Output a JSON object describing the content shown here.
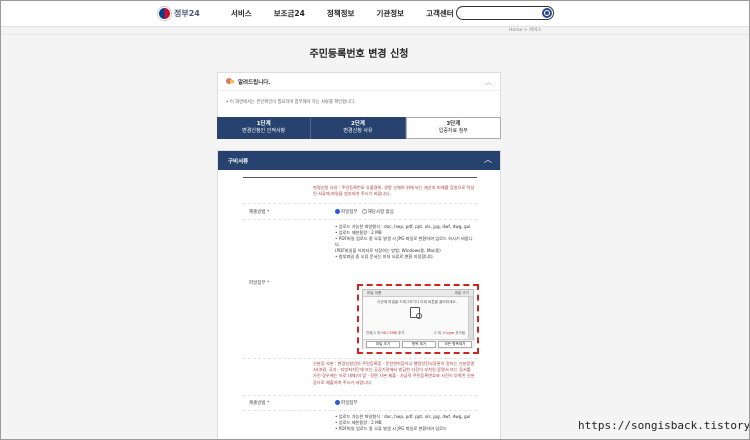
{
  "header": {
    "logo_text": "정부24",
    "nav": [
      "서비스",
      "보조금24",
      "정책정보",
      "기관정보",
      "고객센터"
    ],
    "search_placeholder": ""
  },
  "breadcrumb": "Home  >  서비스",
  "page_title": "주민등록번호 변경 신청",
  "notice": {
    "title": "알려드립니다.",
    "body": "• 이 화면에서는 본인확인이 필요하며 첨부해야 하는 서류를 확인합니다."
  },
  "steps": [
    {
      "num": "1단계",
      "label": "변경신청인 인적사항"
    },
    {
      "num": "2단계",
      "label": "변경신청 사유"
    },
    {
      "num": "3단계",
      "label": "입증자료 첨부"
    }
  ],
  "section": {
    "title": "구비서류",
    "guide1": "변경신청 사유 : 주민등록번호 유출경위, 생명 신체의 위해 또는 재산의 피해를 증빙으로 작성된 서류에 파일을 첨부하여 주시기 바랍니다.",
    "row1_label": "제출방법 *",
    "row1_radio_on": "파일첨부",
    "row1_radio_off": "해당사항 없음",
    "row2_label": "파일첨부 *",
    "bullets1": [
      "• 업로드 가능한 파일형식 : doc, hwp, pdf, ppt, xls, jpg, dwf, dwg, gul",
      "• 업로드 제한용량 : 2 MB",
      "• PDF파일 업로드 중 오류 발생 시 JPG 파일로 변환하여 업로드 하시기 바랍니다.",
      "(PDF파일을 이미지로 저장하는 방법: Windows용, Mac용)",
      "• 첨부파일 중 오류 문서는 지처 오류로 변환 지정합니다."
    ],
    "uploader": {
      "col_name": "파일 이름",
      "col_size": "파일 크기",
      "drop_text": "이곳에 파일을 드래그하거나 아래 버튼을 클릭하세요.",
      "status_left_prefix": "전체 0 개 ",
      "status_left_value": "0B / 2MB",
      "status_left_suffix": " 추가",
      "status_right_prefix": "0 개, ",
      "status_right_value": "0 byte",
      "status_right_suffix": " 추가됨",
      "btn_add": "파일 추가",
      "btn_remove": "항목 제거",
      "btn_remove_all": "모든 항목제거"
    },
    "guide2": "신분증 사본 : 변경신청인의 주민등록증 · 운전면허증이나 행정안전부장관이 정하는 신분증명서(여권, 국가 · 지방자치단체 또는 공공기관에서 발급한 사진이 부착된 증명서 또는 증서를 가진 경우에는 이로 대체)의 앞 · 뒷면 사본 제출 · 가급적 주민등록번호와 사진이 부착된 신분증으로 제출하여 주시기 바랍니다.",
    "row3_label": "제출방법 *",
    "row3_radio_on": "파일첨부",
    "bullets2": [
      "• 업로드 가능한 파일형식 : doc, hwp, pdf, ppt, xls, jpg, dwf, dwg, gul",
      "• 업로드 제한용량 : 2 MB",
      "• PDF파일 업로드 중 오류 발생 시 JPG 파일로 변환하여 업로드"
    ]
  },
  "watermark": "https://songisback.tistory.com/",
  "colors": {
    "navy": "#27426e",
    "red": "#d2231f",
    "guide_text": "#a6373b"
  }
}
